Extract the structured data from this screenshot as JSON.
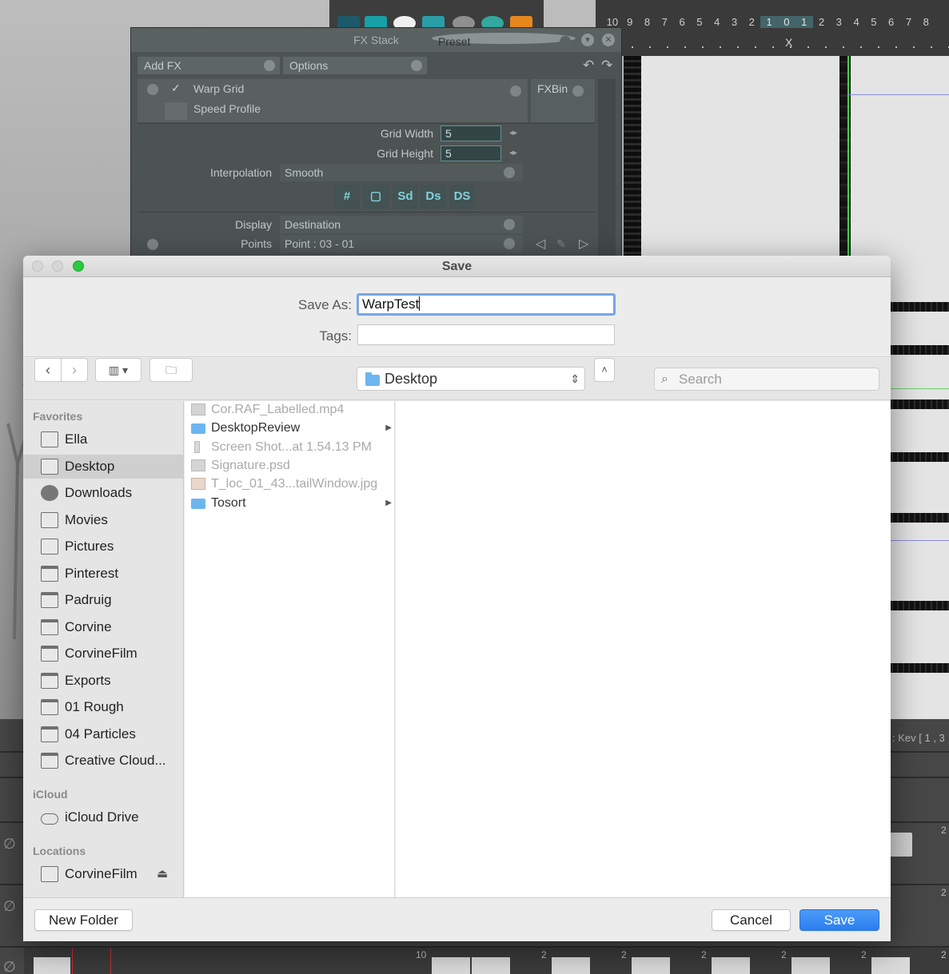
{
  "background_app": {
    "ruler_numbers": [
      "10",
      "9",
      "8",
      "7",
      "6",
      "5",
      "4",
      "3",
      "2",
      "1",
      "0",
      "1",
      "2",
      "3",
      "4",
      "5",
      "6",
      "7",
      "8"
    ],
    "ruler_axis_label": "X",
    "keyframe_readout": ": Kev [ 1 , 3",
    "frame_numbers": [
      "10",
      "2",
      "2",
      "2",
      "2",
      "2",
      "2"
    ],
    "side_numbers": [
      "2",
      "2"
    ]
  },
  "fx_stack": {
    "title": "FX Stack",
    "add_fx": "Add FX",
    "options": "Options",
    "preset": "Preset",
    "effects": [
      {
        "name": "Warp Grid",
        "checked": true
      },
      {
        "name": "Speed Profile",
        "checked": false
      }
    ],
    "fxbin": "FXBin",
    "grid_width_label": "Grid Width",
    "grid_width": "5",
    "grid_height_label": "Grid Height",
    "grid_height": "5",
    "interpolation_label": "Interpolation",
    "interpolation": "Smooth",
    "tools": [
      "grid-tool",
      "rect-tool",
      "Sd",
      "Ds",
      "DS"
    ],
    "display_label": "Display",
    "display": "Destination",
    "points_label": "Points",
    "points": "Point : 03 - 01"
  },
  "dialog": {
    "title": "Save",
    "save_as_label": "Save As:",
    "save_as_value": "WarpTest",
    "tags_label": "Tags:",
    "tags_value": "",
    "location": "Desktop",
    "search_placeholder": "Search",
    "sidebar": {
      "favorites_header": "Favorites",
      "favorites": [
        {
          "label": "Ella",
          "icon": "home-icon"
        },
        {
          "label": "Desktop",
          "icon": "desktop-icon",
          "selected": true
        },
        {
          "label": "Downloads",
          "icon": "downloads-icon"
        },
        {
          "label": "Movies",
          "icon": "movies-icon"
        },
        {
          "label": "Pictures",
          "icon": "camera-icon"
        },
        {
          "label": "Pinterest",
          "icon": "folder-icon"
        },
        {
          "label": "Padruig",
          "icon": "folder-icon"
        },
        {
          "label": "Corvine",
          "icon": "folder-icon"
        },
        {
          "label": "CorvineFilm",
          "icon": "folder-icon"
        },
        {
          "label": "Exports",
          "icon": "folder-icon"
        },
        {
          "label": "01 Rough",
          "icon": "folder-icon"
        },
        {
          "label": "04 Particles",
          "icon": "folder-icon"
        },
        {
          "label": "Creative Cloud...",
          "icon": "folder-icon"
        }
      ],
      "icloud_header": "iCloud",
      "icloud": [
        {
          "label": "iCloud Drive",
          "icon": "cloud-icon"
        }
      ],
      "locations_header": "Locations",
      "locations": [
        {
          "label": "CorvineFilm",
          "icon": "drive-icon",
          "eject": "⏏"
        }
      ]
    },
    "files": [
      {
        "name": "Cor.RAF_Labelled.mp4",
        "kind": "file",
        "dim": true,
        "folder": false
      },
      {
        "name": "DesktopReview",
        "kind": "folder",
        "dim": false,
        "folder": true
      },
      {
        "name": "Screen Shot...at 1.54.13 PM",
        "kind": "thin",
        "dim": true,
        "folder": false
      },
      {
        "name": "Signature.psd",
        "kind": "file",
        "dim": true,
        "folder": false
      },
      {
        "name": "T_loc_01_43...tailWindow.jpg",
        "kind": "img",
        "dim": true,
        "folder": false
      },
      {
        "name": "Tosort",
        "kind": "folder",
        "dim": false,
        "folder": true
      }
    ],
    "new_folder": "New Folder",
    "cancel": "Cancel",
    "save": "Save",
    "colors": {
      "accent": "#2a7ef0",
      "selection": "#cfcfcf",
      "folder": "#6cb6ef"
    }
  }
}
